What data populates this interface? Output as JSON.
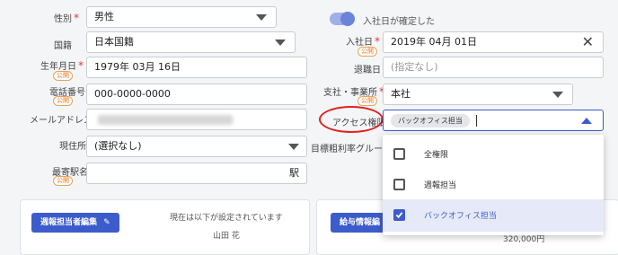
{
  "left": {
    "gender": {
      "label": "性別",
      "value": "男性"
    },
    "nationality": {
      "label": "国籍",
      "value": "日本国籍"
    },
    "birthdate": {
      "label": "生年月日",
      "badge": "公開",
      "value": "1979年 03月 16日"
    },
    "phone": {
      "label": "電話番号",
      "badge": "公開",
      "value": "000-0000-0000"
    },
    "email": {
      "label": "メールアドレス",
      "value": ""
    },
    "address": {
      "label": "現住所",
      "value": "(選択なし)"
    },
    "nearest_station": {
      "label": "最寄駅名",
      "badge": "公開",
      "suffix": "駅"
    }
  },
  "right": {
    "toggle_label": "入社日が確定した",
    "join_date": {
      "label": "入社日",
      "badge": "公開",
      "value": "2019年 04月 01日"
    },
    "leave_date": {
      "label": "退職日",
      "placeholder": "(指定なし)"
    },
    "branch": {
      "label": "支社・事業所",
      "badge": "公開",
      "value": "本社"
    },
    "access": {
      "label": "アクセス権限",
      "chip": "バックオフィス担当"
    },
    "benefit_group_label": "目標粗利率グループ"
  },
  "dropdown": {
    "options": [
      {
        "label": "全権限",
        "checked": false
      },
      {
        "label": "週報担当",
        "checked": false
      },
      {
        "label": "バックオフィス担当",
        "checked": true
      }
    ]
  },
  "bottom": {
    "weekly_edit_button": "週報担当者編集",
    "current_setting_text": "現在は以下が設定されています",
    "current_person": "山田 花",
    "salary_button": "給与情報編",
    "salary_value": "320,000円"
  }
}
